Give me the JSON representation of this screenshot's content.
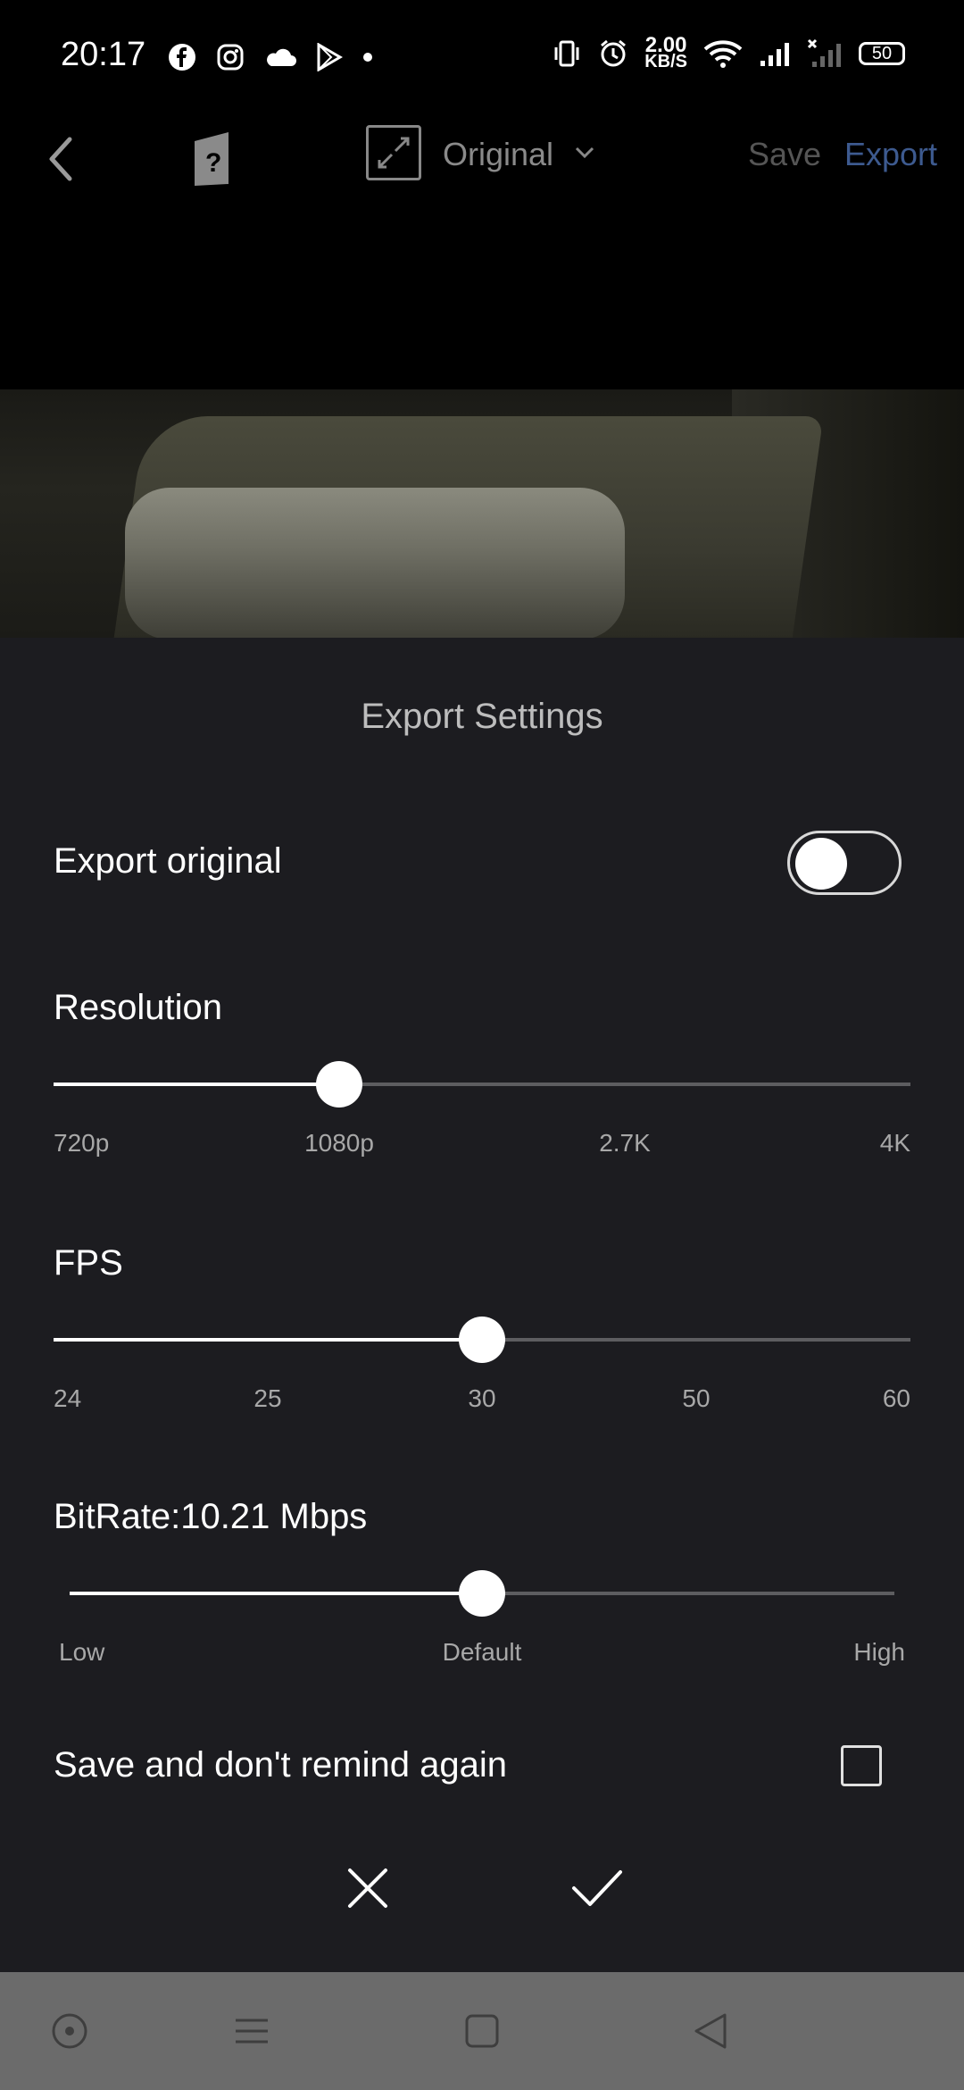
{
  "status_bar": {
    "time": "20:17",
    "net_speed_value": "2.00",
    "net_speed_unit": "KB/S",
    "battery": "50",
    "left_icons": [
      "facebook-icon",
      "instagram-icon",
      "cloud-icon",
      "play-store-icon",
      "dot-icon"
    ],
    "right_icons": [
      "vibrate-icon",
      "alarm-icon",
      "wifi-icon",
      "signal-icon",
      "signal-x-icon"
    ]
  },
  "toolbar": {
    "aspect_label": "Original",
    "save_label": "Save",
    "export_label": "Export"
  },
  "sheet": {
    "title": "Export Settings",
    "export_original": {
      "label": "Export original",
      "on": false
    },
    "resolution": {
      "label": "Resolution",
      "ticks": [
        "720p",
        "1080p",
        "2.7K",
        "4K"
      ],
      "selected": "1080p"
    },
    "fps": {
      "label": "FPS",
      "ticks": [
        "24",
        "25",
        "30",
        "50",
        "60"
      ],
      "selected": "30"
    },
    "bitrate": {
      "label": "BitRate:10.21 Mbps",
      "ticks": [
        "Low",
        "Default",
        "High"
      ],
      "level": 0.5
    },
    "dont_remind": {
      "label": "Save and don't remind again",
      "checked": false
    }
  },
  "colors": {
    "sheet_bg": "#1c1c20",
    "accent_export": "#3d5a8f",
    "navbar_bg": "#6b6b6b"
  }
}
